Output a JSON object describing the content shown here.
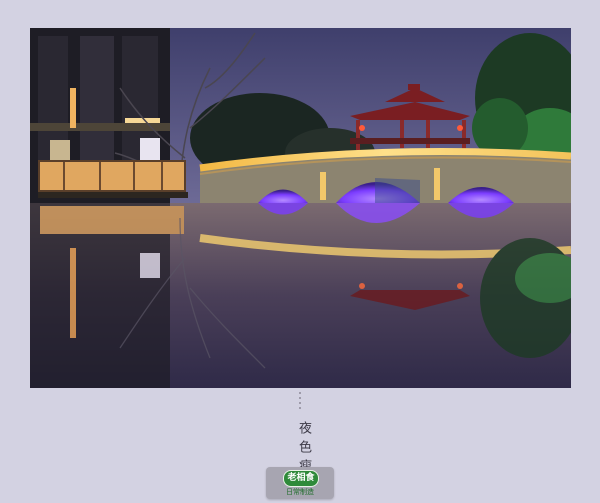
{
  "photo": {
    "subject": "night-bridge-canal-photo"
  },
  "caption": {
    "text": "夜色瘦"
  },
  "badge": {
    "logo_text": "老相食",
    "sub_text": "日常制造"
  },
  "colors": {
    "background": "#d3d2e2",
    "sky": "#4a4a78",
    "bridge_light": "#f6c85a",
    "arch_glow": "#7c3cff",
    "water": "#2b2744",
    "logo_green": "#2f8a3a"
  }
}
